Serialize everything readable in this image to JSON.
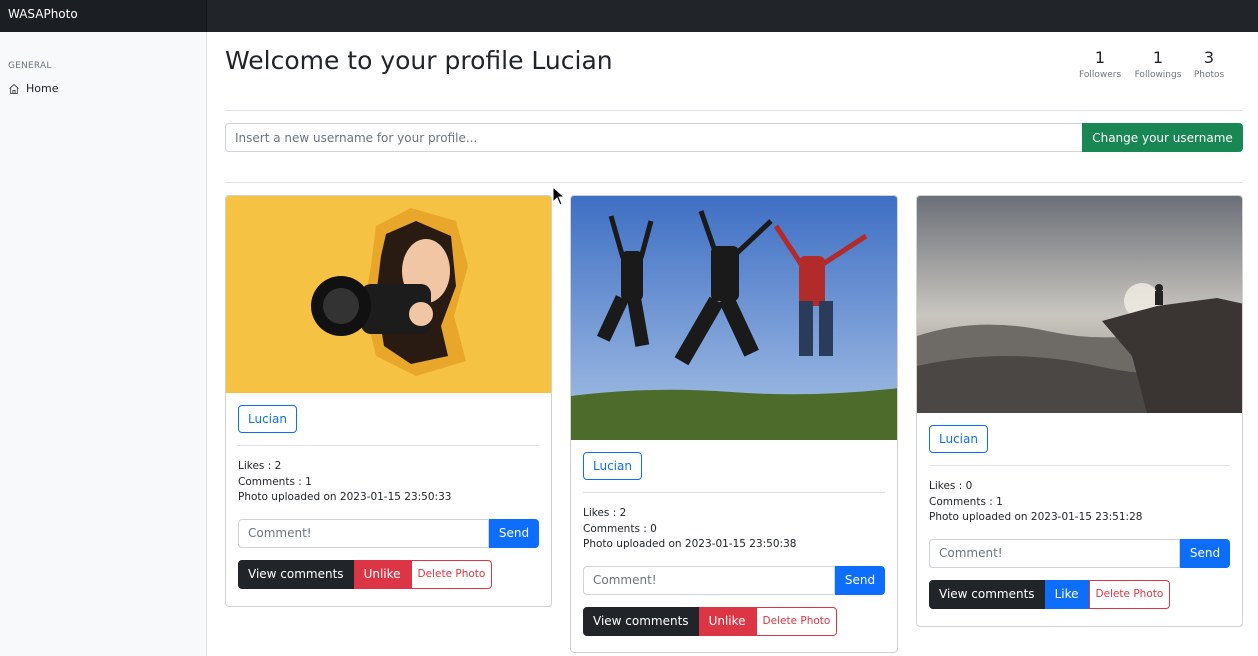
{
  "app": {
    "brand": "WASAPhoto"
  },
  "sidebar": {
    "heading": "GENERAL",
    "items": [
      {
        "label": "Home",
        "icon": "home-icon"
      }
    ]
  },
  "profile": {
    "title": "Welcome to your profile Lucian",
    "stats": [
      {
        "value": "1",
        "label": "Followers"
      },
      {
        "value": "1",
        "label": "Followings"
      },
      {
        "value": "3",
        "label": "Photos"
      }
    ],
    "username_placeholder": "Insert a new username for your profile...",
    "change_username_label": "Change your username"
  },
  "photos": [
    {
      "owner": "Lucian",
      "likes": "Likes : 2",
      "comments": "Comments : 1",
      "uploaded": "Photo uploaded on 2023-01-15 23:50:33",
      "comment_placeholder": "Comment!",
      "send_label": "Send",
      "view_comments_label": "View comments",
      "like_toggle_label": "Unlike",
      "delete_label": "Delete Photo"
    },
    {
      "owner": "Lucian",
      "likes": "Likes : 2",
      "comments": "Comments : 0",
      "uploaded": "Photo uploaded on 2023-01-15 23:50:38",
      "comment_placeholder": "Comment!",
      "send_label": "Send",
      "view_comments_label": "View comments",
      "like_toggle_label": "Unlike",
      "delete_label": "Delete Photo"
    },
    {
      "owner": "Lucian",
      "likes": "Likes : 0",
      "comments": "Comments : 1",
      "uploaded": "Photo uploaded on 2023-01-15 23:51:28",
      "comment_placeholder": "Comment!",
      "send_label": "Send",
      "view_comments_label": "View comments",
      "like_toggle_label": "Like",
      "delete_label": "Delete Photo"
    }
  ],
  "colors": {
    "navbar": "#212529",
    "success": "#198754",
    "primary": "#0d6efd",
    "danger": "#dc3545",
    "dark": "#212529"
  }
}
